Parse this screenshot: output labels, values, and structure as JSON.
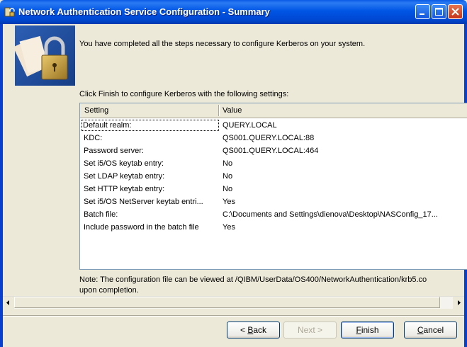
{
  "window": {
    "title": "Network Authentication Service Configuration - Summary"
  },
  "intro_text": "You have completed all the steps necessary to configure Kerberos on your system.",
  "prompt_text": "Click Finish to configure Kerberos with the following settings:",
  "table": {
    "headers": {
      "setting": "Setting",
      "value": "Value"
    },
    "rows": [
      {
        "setting": "Default realm:",
        "value": "QUERY.LOCAL"
      },
      {
        "setting": "KDC:",
        "value": "QS001.QUERY.LOCAL:88"
      },
      {
        "setting": "Password server:",
        "value": "QS001.QUERY.LOCAL:464"
      },
      {
        "setting": "Set i5/OS keytab entry:",
        "value": "No"
      },
      {
        "setting": "Set LDAP keytab entry:",
        "value": "No"
      },
      {
        "setting": "Set HTTP keytab entry:",
        "value": "No"
      },
      {
        "setting": "Set i5/OS NetServer keytab entri...",
        "value": "Yes"
      },
      {
        "setting": "Batch file:",
        "value": "C:\\Documents and Settings\\dienova\\Desktop\\NASConfig_17..."
      },
      {
        "setting": "Include password in the batch file",
        "value": "Yes"
      }
    ]
  },
  "note": {
    "line1": "Note: The configuration file can be viewed at /QIBM/UserData/OS400/NetworkAuthentication/krb5.co",
    "line2": "upon completion."
  },
  "buttons": {
    "back": {
      "prefix": "< ",
      "mnemonic": "B",
      "rest": "ack"
    },
    "next": {
      "label": "Next >"
    },
    "finish": {
      "mnemonic": "F",
      "rest": "inish"
    },
    "cancel": {
      "mnemonic": "C",
      "rest": "ancel"
    }
  },
  "colors": {
    "titlebar": "#0055E4",
    "dialog_bg": "#ECE9D8",
    "table_border": "#7F9DB9"
  },
  "icons": {
    "app": "lock-key-icon",
    "header": "padlock-header-icon"
  }
}
